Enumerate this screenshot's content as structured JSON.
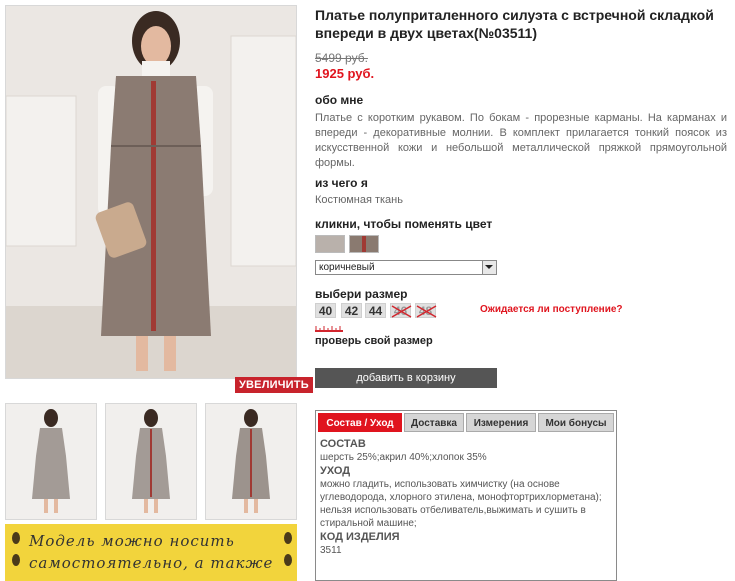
{
  "product": {
    "title": "Платье полуприталенного силуэта с встречной складкой впереди в двух цветах(№03511)",
    "old_price": "5499 руб.",
    "new_price": "1925 руб."
  },
  "gallery": {
    "zoom_label": "УВЕЛИЧИТЬ",
    "promo_line1": "Модель можно носить",
    "promo_line2": "самостоятельно, а также"
  },
  "about": {
    "heading": "обо мне",
    "text": "Платье с коротким рукавом. По бокам - прорезные карманы. На карманах и впереди - декоративные молнии. В комплект прилагается тонкий поясок из искусственной кожи и небольшой металлической пряжкой прямоугольной формы."
  },
  "material": {
    "heading": "из чего я",
    "text": "Костюмная ткань"
  },
  "color": {
    "heading": "кликни, чтобы поменять цвет",
    "selected": "коричневый",
    "swatch_colors": [
      "#b9b1ab",
      "#8a7a70"
    ]
  },
  "size": {
    "heading": "выбери размер",
    "options": [
      "40",
      "42",
      "44",
      "46",
      "48"
    ],
    "waiting_link": "Ожидается ли поступление?",
    "check_link": "проверь свой размер"
  },
  "cart": {
    "button_label": "добавить в корзину"
  },
  "tabs": {
    "items": [
      "Состав / Уход",
      "Доставка",
      "Измерения",
      "Мои бонусы"
    ],
    "composition_heading": "СОСТАВ",
    "composition_text": "шерсть 25%;акрил 40%;хлопок 35%",
    "care_heading": "УХОД",
    "care_text": "можно гладить, использовать химчистку (на основе углеводорода, хлорного этилена, монофтортрихлорметана); нельзя использовать отбеливатель,выжимать и сушить в стиральной машине;",
    "code_heading": "КОД ИЗДЕЛИЯ",
    "code_value": "3511"
  },
  "colors": {
    "accent_red": "#e0141e",
    "cart_button": "#555555",
    "promo_yellow": "#f2d43c"
  }
}
